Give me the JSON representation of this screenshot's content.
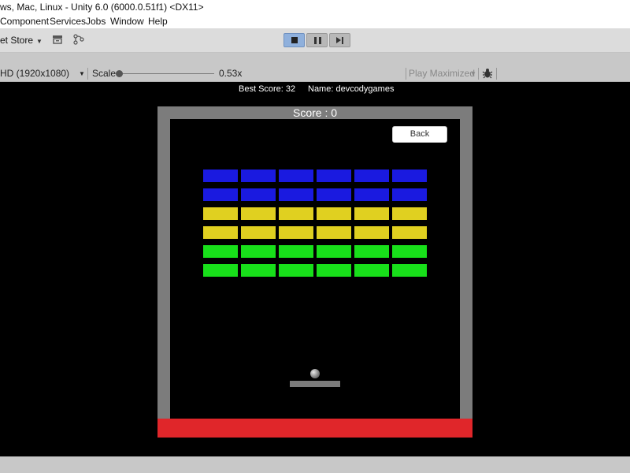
{
  "window": {
    "title": "ws, Mac, Linux - Unity 6.0 (6000.0.51f1) <DX11>"
  },
  "menu": [
    {
      "label": "Component"
    },
    {
      "label": "Services"
    },
    {
      "label": "Jobs"
    },
    {
      "label": "Window"
    },
    {
      "label": "Help"
    }
  ],
  "toolbar": {
    "asset_store": "et Store",
    "icons": [
      "archive-icon",
      "version-control-icon"
    ],
    "play_controls": [
      "stop-icon",
      "pause-icon",
      "step-icon"
    ]
  },
  "game_toolbar": {
    "resolution": "HD (1920x1080)",
    "scale_label": "Scale",
    "scale_value": "0.53x",
    "scale_fraction": 0.0,
    "play_mode": "Play Maximized"
  },
  "game": {
    "best_score": "Best Score: 32",
    "player_name": "Name: devcodygames",
    "score": "Score : 0",
    "back_label": "Back",
    "colors": {
      "wall": "#7c7c7c",
      "lava": "#e0262a",
      "blue": "#1a1ae0",
      "yellow": "#e0d020",
      "green": "#18e01a"
    },
    "brick_rows": [
      "blue",
      "blue",
      "yellow",
      "yellow",
      "green",
      "green"
    ],
    "bricks_per_row": 6
  }
}
